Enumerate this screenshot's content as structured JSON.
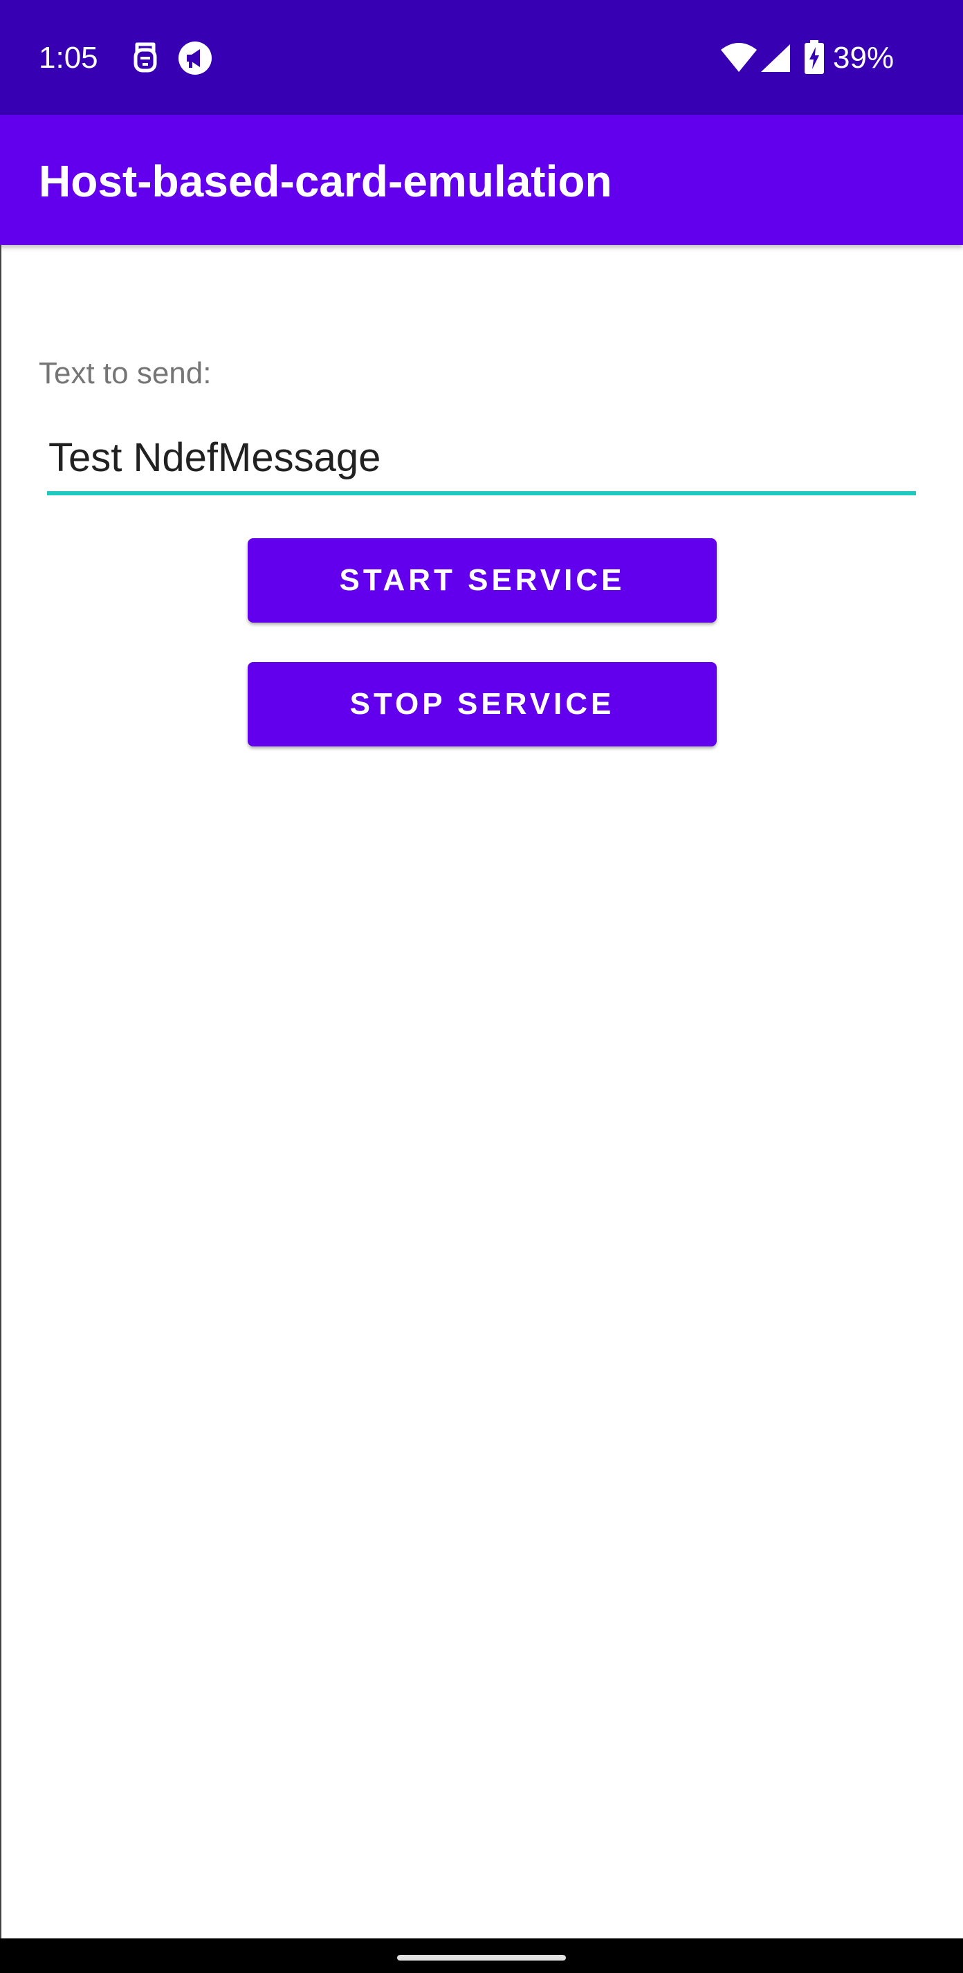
{
  "status_bar": {
    "time": "1:05",
    "battery": "39%",
    "icons": [
      "face-unlock-icon",
      "megaphone-icon",
      "wifi-icon",
      "cellular-signal-icon",
      "battery-charging-icon"
    ],
    "bg_color": "#3700b3"
  },
  "app_bar": {
    "title": "Host-based-card-emulation",
    "bg_color": "#6200ee"
  },
  "form": {
    "label": "Text to send:",
    "input_value": "Test NdefMessage",
    "underline_color": "#20c9c0"
  },
  "buttons": {
    "start_label": "START SERVICE",
    "stop_label": "STOP SERVICE",
    "color": "#6200ee"
  }
}
